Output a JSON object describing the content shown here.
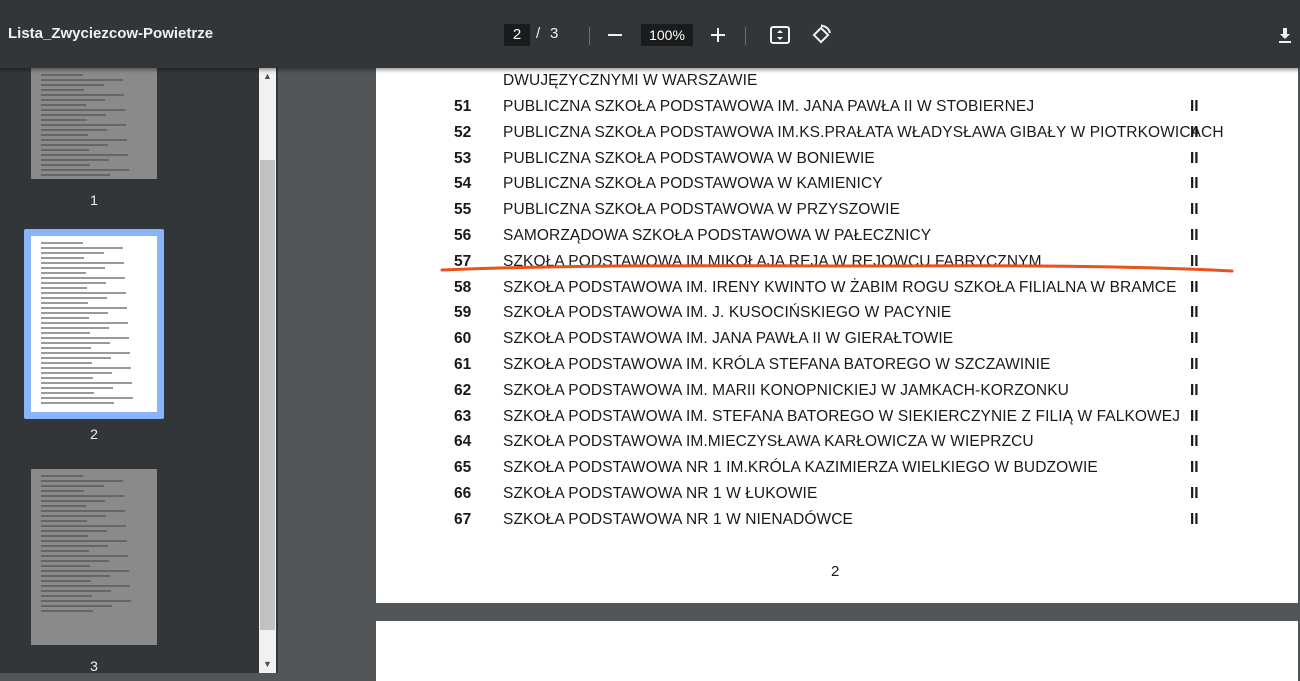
{
  "toolbar": {
    "title": "Lista_Zwyciezcow-Powietrze",
    "current_page": "2",
    "separator": "/",
    "total_pages": "3",
    "zoom": "100%"
  },
  "sidebar": {
    "thumbnails": [
      {
        "label": "1"
      },
      {
        "label": "2"
      },
      {
        "label": "3"
      }
    ]
  },
  "document": {
    "continuation": "DWUJĘZYCZNYMI W WARSZAWIE",
    "rows": [
      {
        "num": "51",
        "name": "PUBLICZNA SZKOŁA PODSTAWOWA IM. JANA PAWŁA II W STOBIERNEJ",
        "cat": "II"
      },
      {
        "num": "52",
        "name": "PUBLICZNA SZKOŁA PODSTAWOWA IM.KS.PRAŁATA WŁADYSŁAWA GIBAŁY W PIOTRKOWICACH",
        "cat": "II"
      },
      {
        "num": "53",
        "name": "PUBLICZNA SZKOŁA PODSTAWOWA W BONIEWIE",
        "cat": "II"
      },
      {
        "num": "54",
        "name": "PUBLICZNA SZKOŁA PODSTAWOWA W KAMIENICY",
        "cat": "II"
      },
      {
        "num": "55",
        "name": "PUBLICZNA SZKOŁA PODSTAWOWA W PRZYSZOWIE",
        "cat": "II"
      },
      {
        "num": "56",
        "name": "SAMORZĄDOWA SZKOŁA PODSTAWOWA W PAŁECZNICY",
        "cat": "II"
      },
      {
        "num": "57",
        "name": "SZKOŁA PODSTAWOWA IM MIKOŁAJA REJA W REJOWCU FABRYCZNYM",
        "cat": "II"
      },
      {
        "num": "58",
        "name": "SZKOŁA PODSTAWOWA IM. IRENY KWINTO W ŻABIM ROGU SZKOŁA FILIALNA W BRAMCE",
        "cat": "II"
      },
      {
        "num": "59",
        "name": "SZKOŁA PODSTAWOWA IM. J. KUSOCIŃSKIEGO W PACYNIE",
        "cat": "II"
      },
      {
        "num": "60",
        "name": "SZKOŁA PODSTAWOWA IM. JANA PAWŁA II W GIERAŁTOWIE",
        "cat": "II"
      },
      {
        "num": "61",
        "name": "SZKOŁA PODSTAWOWA IM. KRÓLA STEFANA BATOREGO W SZCZAWINIE",
        "cat": "II"
      },
      {
        "num": "62",
        "name": "SZKOŁA PODSTAWOWA IM. MARII KONOPNICKIEJ W JAMKACH-KORZONKU",
        "cat": "II"
      },
      {
        "num": "63",
        "name": "SZKOŁA PODSTAWOWA IM. STEFANA BATOREGO W SIEKIERCZYNIE Z FILIĄ W FALKOWEJ",
        "cat": "II"
      },
      {
        "num": "64",
        "name": "SZKOŁA PODSTAWOWA IM.MIECZYSŁAWA KARŁOWICZA W WIEPRZCU",
        "cat": "II"
      },
      {
        "num": "65",
        "name": "SZKOŁA PODSTAWOWA NR 1 IM.KRÓLA KAZIMIERZA WIELKIEGO W BUDZOWIE",
        "cat": "II"
      },
      {
        "num": "66",
        "name": "SZKOŁA PODSTAWOWA NR 1 W ŁUKOWIE",
        "cat": "II"
      },
      {
        "num": "67",
        "name": "SZKOŁA PODSTAWOWA NR 1 W NIENADÓWCE",
        "cat": "II"
      }
    ],
    "page_number": "2"
  },
  "annotation": {
    "underline_color": "#e8531e"
  }
}
